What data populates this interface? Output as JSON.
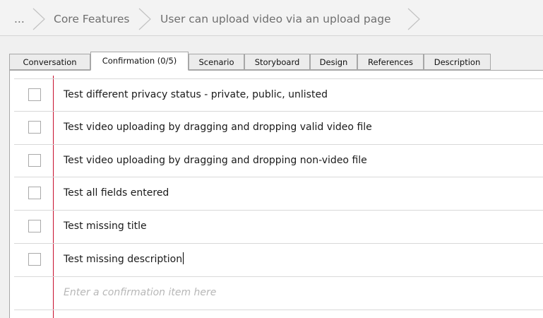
{
  "breadcrumb": {
    "items": [
      "...",
      "Core Features",
      "User can upload video via an upload page"
    ]
  },
  "tabs": [
    {
      "label": "Conversation",
      "active": false
    },
    {
      "label": "Confirmation (0/5)",
      "active": true
    },
    {
      "label": "Scenario",
      "active": false
    },
    {
      "label": "Storyboard",
      "active": false
    },
    {
      "label": "Design",
      "active": false
    },
    {
      "label": "References",
      "active": false
    },
    {
      "label": "Description",
      "active": false
    }
  ],
  "confirmations": [
    {
      "text": "Test different privacy status - private, public, unlisted",
      "checked": false
    },
    {
      "text": "Test video uploading by dragging and dropping valid video file",
      "checked": false
    },
    {
      "text": "Test video uploading by dragging and dropping non-video file",
      "checked": false
    },
    {
      "text": "Test all fields entered",
      "checked": false
    },
    {
      "text": "Test missing title",
      "checked": false
    },
    {
      "text": "Test missing description",
      "checked": false
    }
  ],
  "new_item": {
    "placeholder": "Enter a confirmation item here"
  }
}
